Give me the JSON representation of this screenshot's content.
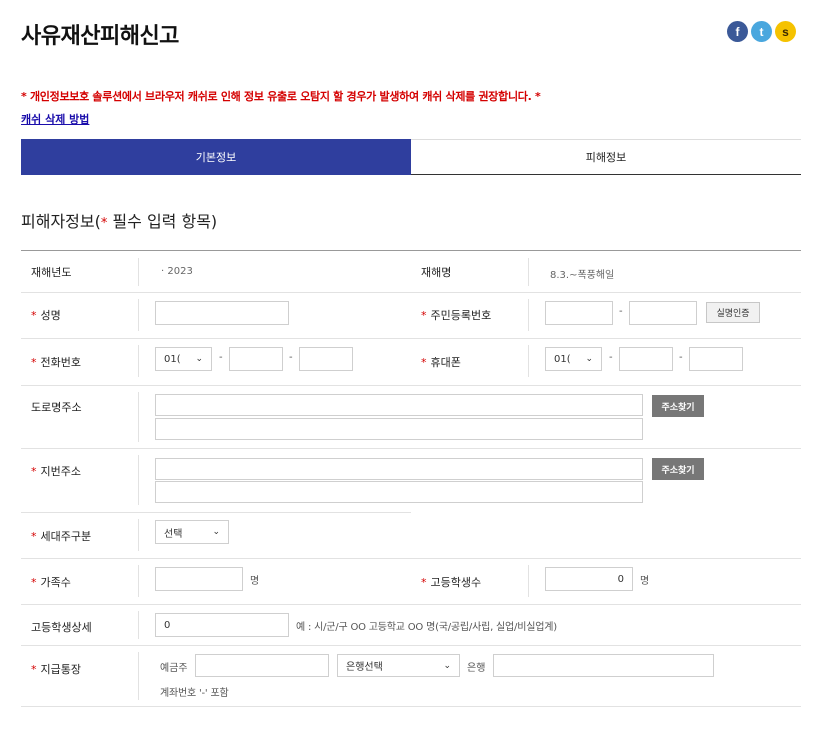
{
  "page": {
    "title": "사유재산피해신고"
  },
  "share": {
    "facebook": "f",
    "twitter": "t",
    "kakao": "s"
  },
  "notice": {
    "warning": "* 개인정보보호 솔루션에서 브라우저 캐쉬로 인해 정보 유출로 오탐지 할 경우가 발생하여 캐쉬 삭제를 권장합니다. *",
    "cache_link": "캐쉬 삭제 방법"
  },
  "tabs": [
    {
      "label": "기본정보",
      "active": true
    },
    {
      "label": "피해정보",
      "active": false
    }
  ],
  "section": {
    "title": "피해자정보(",
    "req_star": "*",
    "title_suffix": " 필수 입력 항목)"
  },
  "form": {
    "required_mark": "*",
    "disaster_year": {
      "label": "재해년도",
      "value": "· 2023"
    },
    "disaster_name": {
      "label": "재해명",
      "value": "8.3.~폭풍해일"
    },
    "name": {
      "label": "성명",
      "value": ""
    },
    "rrn": {
      "label": "주민등록번호",
      "dash": "-",
      "verify_button": "실명인증"
    },
    "phone": {
      "label": "전화번호",
      "area_code": "01(",
      "dash": "-"
    },
    "mobile": {
      "label": "휴대폰",
      "prefix": "01(",
      "dash": "-"
    },
    "road_address": {
      "label": "도로명주소",
      "button": "주소찾기"
    },
    "lot_address": {
      "label": "지번주소",
      "button": "주소찾기"
    },
    "household_type": {
      "label": "세대주구분",
      "selected": "선택"
    },
    "family_count": {
      "label": "가족수",
      "value": "",
      "unit": "명"
    },
    "hs_student_count": {
      "label": "고등학생수",
      "value": "0",
      "unit": "명"
    },
    "hs_student_detail": {
      "label": "고등학생상세",
      "value": "0",
      "hint": "예 : 시/군/구 OO 고등학교 OO 명(국/공립/사립, 실업/비실업계)"
    },
    "bank_account": {
      "label": "지급통장",
      "holder_label": "예금주",
      "bank_select": "은행선택",
      "bank_label": "은행",
      "note": "계좌번호 '-' 포함"
    }
  }
}
